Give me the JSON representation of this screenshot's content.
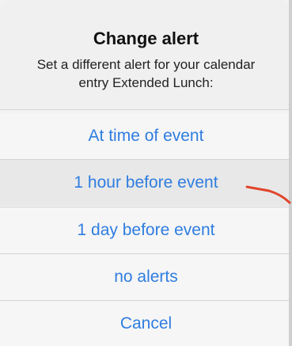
{
  "alert": {
    "title": "Change alert",
    "message": "Set a different alert for your calendar entry Extended Lunch:",
    "options": [
      {
        "label": "At time of event"
      },
      {
        "label": "1 hour before event"
      },
      {
        "label": "1 day before event"
      },
      {
        "label": "no alerts"
      },
      {
        "label": "Cancel"
      }
    ]
  },
  "colors": {
    "action_text": "#2f7de0",
    "annotation_arrow": "#e0452b"
  }
}
